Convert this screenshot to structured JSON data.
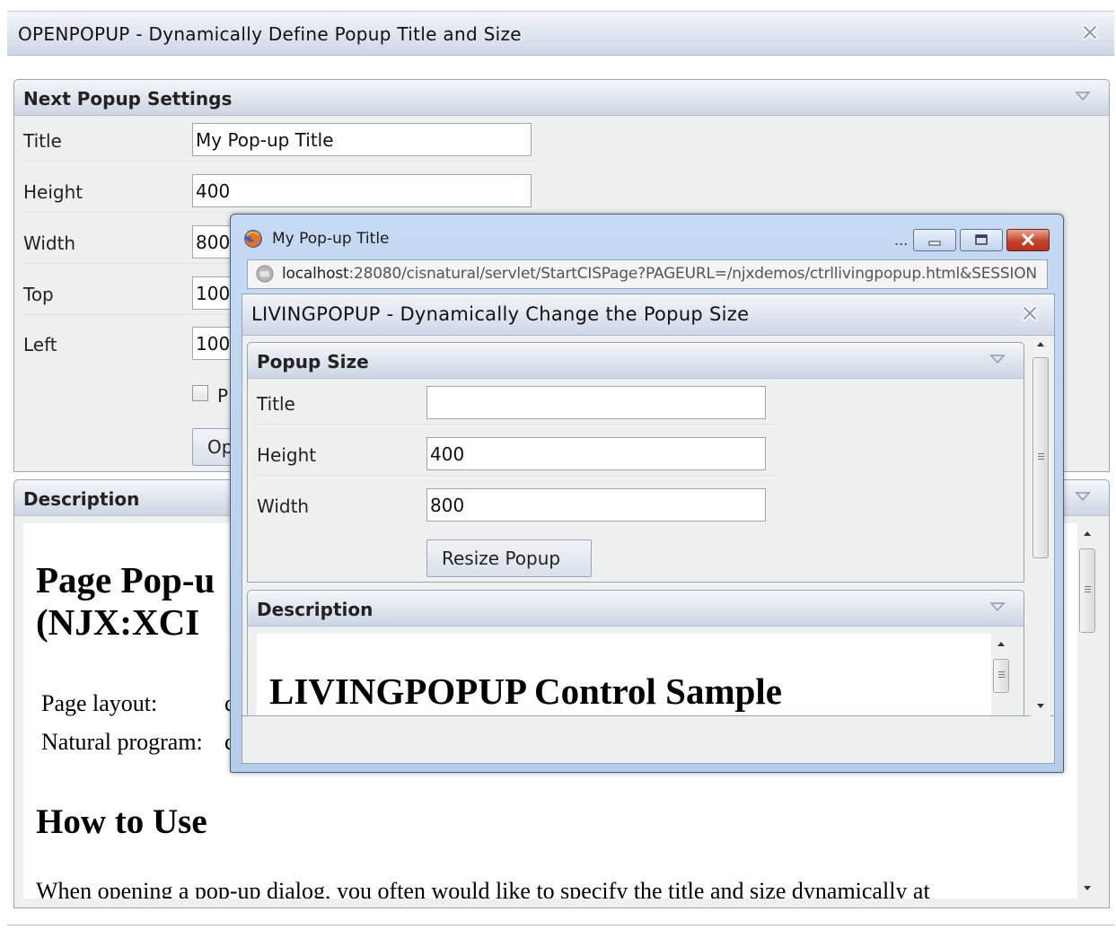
{
  "page": {
    "title": "OPENPOPUP - Dynamically Define Popup Title and Size",
    "settings_panel": {
      "title": "Next Popup Settings",
      "fields": [
        {
          "label": "Title",
          "value": "My Pop-up Title"
        },
        {
          "label": "Height",
          "value": "400"
        },
        {
          "label": "Width",
          "value": "800"
        },
        {
          "label": "Top",
          "value": "100"
        },
        {
          "label": "Left",
          "value": "100"
        }
      ],
      "checkbox_label": "P",
      "open_button_label": "Op"
    },
    "description_panel": {
      "title": "Description",
      "heading_1": "Page Pop-u",
      "heading_1b": "(NJX:XCI",
      "page_layout_label": "Page layout:",
      "page_layout_value": "c",
      "natural_program_label": "Natural program:",
      "natural_program_value": "c",
      "heading_2": "How to Use",
      "paragraph": "When opening a pop-up dialog, you often would like to specify the title and size dynamically at"
    }
  },
  "popup_window": {
    "window_title": "My Pop-up Title",
    "ellipsis": "...",
    "url_host": "localhost",
    "url_rest": ":28080/cisnatural/servlet/StartCISPage?PAGEURL=/njxdemos/ctrllivingpopup.html&SESSION",
    "inner_title": "LIVINGPOPUP - Dynamically Change the Popup Size",
    "size_panel": {
      "title": "Popup Size",
      "fields": [
        {
          "label": "Title",
          "value": ""
        },
        {
          "label": "Height",
          "value": "400"
        },
        {
          "label": "Width",
          "value": "800"
        }
      ],
      "resize_button_label": "Resize Popup"
    },
    "description_panel": {
      "title": "Description",
      "heading": "LIVINGPOPUP Control Sample"
    }
  },
  "icons": [
    "close-icon",
    "collapse-triangle-icon",
    "firefox-icon",
    "globe-icon",
    "minimize-icon",
    "maximize-icon"
  ]
}
